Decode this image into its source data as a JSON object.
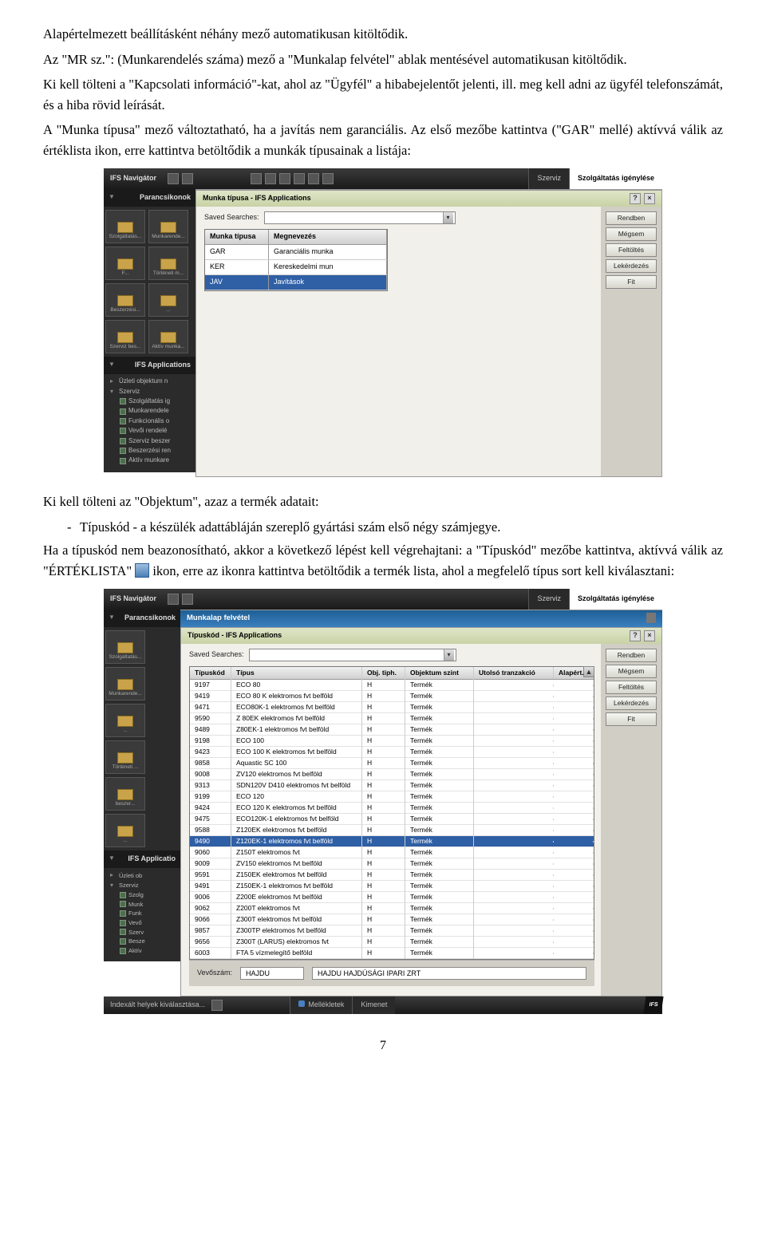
{
  "para": {
    "p1": "Alapértelmezett beállításként néhány mező automatikusan kitöltődik.",
    "p2": "Az \"MR sz.\": (Munkarendelés száma) mező a \"Munkalap felvétel\" ablak mentésével automatikusan kitöltődik.",
    "p3": "Ki kell tölteni a \"Kapcsolati információ\"-kat, ahol az \"Ügyfél\" a hibabejelentőt jelenti, ill. meg kell adni az ügyfél telefonszámát, és a hiba rövid leírását.",
    "p4": "A \"Munka típusa\" mező változtatható, ha a javítás nem garanciális. Az első mezőbe kattintva (\"GAR\" mellé) aktívvá válik az értéklista ikon, erre kattintva betöltődik a munkák típusainak a listája:",
    "p5": "Ki kell tölteni az \"Objektum\", azaz a termék adatait:",
    "bullet": "Típuskód - a készülék adattábláján szereplő gyártási szám első négy számjegye.",
    "p6a": "Ha a típuskód nem beazonosítható, akkor a következő lépést kell végrehajtani: a \"Típuskód\" mezőbe kattintva, aktívvá válik az \"ÉRTÉKLISTA\"",
    "p6b": "ikon, erre az ikonra kattintva betöltődik a termék lista, ahol a megfelelő típus sort kell kiválasztani:"
  },
  "page_number": "7",
  "shot1": {
    "nav_title": "IFS Navigátor",
    "bc": {
      "szerviz": "Szerviz",
      "igeny": "Szolgáltatás igénylése"
    },
    "parancs": "Parancsikonok",
    "ifs_apps": "IFS Applications",
    "tiles": [
      "Szolgáltatás...",
      "Munkarende...",
      "F...",
      "Történeti m...",
      "Beszerzési...",
      "...",
      "Szerviz bes...",
      "Aktív munka..."
    ],
    "tree": {
      "uzleti": "Üzleti objektum n",
      "szerviz": "Szerviz",
      "items": [
        "Szolgáltatás ig",
        "Munkarendele",
        "Funkcionális o",
        "Vevői rendelé",
        "Szerviz beszer",
        "Beszerzési ren",
        "Aktív munkare"
      ]
    },
    "dlg_title": "Munka típusa - IFS Applications",
    "saved": "Saved Searches:",
    "cols": {
      "c1": "Munka típusa",
      "c2": "Megnevezés"
    },
    "rows": [
      {
        "a": "GAR",
        "b": "Garanciális munka"
      },
      {
        "a": "KER",
        "b": "Kereskedelmi mun"
      },
      {
        "a": "JAV",
        "b": "Javítások"
      }
    ],
    "selected_row": 2,
    "buttons": [
      "Rendben",
      "Mégsem",
      "Feltöltés",
      "Lekérdezés",
      "Fit"
    ]
  },
  "shot2": {
    "nav_title": "IFS Navigátor",
    "bc": {
      "szerviz": "Szerviz",
      "igeny": "Szolgáltatás igénylése"
    },
    "parancs": "Parancsikonok",
    "work_title": "Munkalap felvétel",
    "dlg_title": "Típuskód - IFS Applications",
    "saved": "Saved Searches:",
    "ifs_apps": "IFS Applicatio",
    "tiles": [
      "Szolgáltatás...",
      "Munkarende...",
      "...",
      "Történeti ...",
      "beszer...",
      "..."
    ],
    "tree_short": {
      "uzleti": "Üzleti ob",
      "szerviz": "Szerviz",
      "items": [
        "Szolg",
        "Munk",
        "Funk",
        "Vevő",
        "Szerv",
        "Besze",
        "Aktív"
      ]
    },
    "cols": {
      "c1": "Típuskód",
      "c2": "Típus",
      "c3": "Obj. tiph.",
      "c4": "Objektum szint",
      "c5": "Utolsó tranzakció",
      "c6": "Alapért."
    },
    "rows": [
      {
        "a": "9197",
        "b": "ECO 80",
        "c": "H",
        "d": "Termék"
      },
      {
        "a": "9419",
        "b": "ECO 80 K elektromos fvt belföld",
        "c": "H",
        "d": "Termék"
      },
      {
        "a": "9471",
        "b": "ECO80K-1 elektromos fvt belföld",
        "c": "H",
        "d": "Termék"
      },
      {
        "a": "9590",
        "b": "Z 80EK elektromos fvt belföld",
        "c": "H",
        "d": "Termék"
      },
      {
        "a": "9489",
        "b": "Z80EK-1 elektromos fvt belföld",
        "c": "H",
        "d": "Termék"
      },
      {
        "a": "9198",
        "b": "ECO 100",
        "c": "H",
        "d": "Termék"
      },
      {
        "a": "9423",
        "b": "ECO 100 K elektromos fvt belföld",
        "c": "H",
        "d": "Termék"
      },
      {
        "a": "9858",
        "b": "Aquastic SC 100",
        "c": "H",
        "d": "Termék"
      },
      {
        "a": "9008",
        "b": "ZV120 elektromos fvt belföld",
        "c": "H",
        "d": "Termék"
      },
      {
        "a": "9313",
        "b": "SDN120V D410 elektromos fvt belföld",
        "c": "H",
        "d": "Termék"
      },
      {
        "a": "9199",
        "b": "ECO 120",
        "c": "H",
        "d": "Termék"
      },
      {
        "a": "9424",
        "b": "ECO 120 K elektromos fvt belföld",
        "c": "H",
        "d": "Termék"
      },
      {
        "a": "9475",
        "b": "ECO120K-1 elektromos fvt belföld",
        "c": "H",
        "d": "Termék"
      },
      {
        "a": "9588",
        "b": "Z120EK elektromos fvt belföld",
        "c": "H",
        "d": "Termék"
      },
      {
        "a": "9490",
        "b": "Z120EK-1 elektromos fvt belföld",
        "c": "H",
        "d": "Termék"
      },
      {
        "a": "9060",
        "b": "Z150T elektromos fvt",
        "c": "H",
        "d": "Termék"
      },
      {
        "a": "9009",
        "b": "ZV150 elektromos fvt belföld",
        "c": "H",
        "d": "Termék"
      },
      {
        "a": "9591",
        "b": "Z150EK elektromos fvt belföld",
        "c": "H",
        "d": "Termék"
      },
      {
        "a": "9491",
        "b": "Z150EK-1 elektromos fvt belföld",
        "c": "H",
        "d": "Termék"
      },
      {
        "a": "9006",
        "b": "Z200E elektromos fvt belföld",
        "c": "H",
        "d": "Termék"
      },
      {
        "a": "9062",
        "b": "Z200T elektromos fvt",
        "c": "H",
        "d": "Termék"
      },
      {
        "a": "9066",
        "b": "Z300T elektromos fvt belföld",
        "c": "H",
        "d": "Termék"
      },
      {
        "a": "9857",
        "b": "Z300TP elektromos fvt belföld",
        "c": "H",
        "d": "Termék"
      },
      {
        "a": "9656",
        "b": "Z300T (LARUS) elektromos fvt",
        "c": "H",
        "d": "Termék"
      },
      {
        "a": "6003",
        "b": "FTA 5 vízmelegítő belföld",
        "c": "H",
        "d": "Termék"
      }
    ],
    "selected_row": 14,
    "buttons": [
      "Rendben",
      "Mégsem",
      "Feltöltés",
      "Lekérdezés",
      "Fit"
    ],
    "footer": {
      "lbl": "Vevőszám:",
      "val": "HAJDU",
      "name": "HAJDU HAJDÚSÁGI IPARI ZRT"
    },
    "bottom": {
      "idx": "Indexált helyek kiválasztása...",
      "tab1": "Mellékletek",
      "tab2": "Kimenet",
      "ifs": "IFS"
    }
  }
}
